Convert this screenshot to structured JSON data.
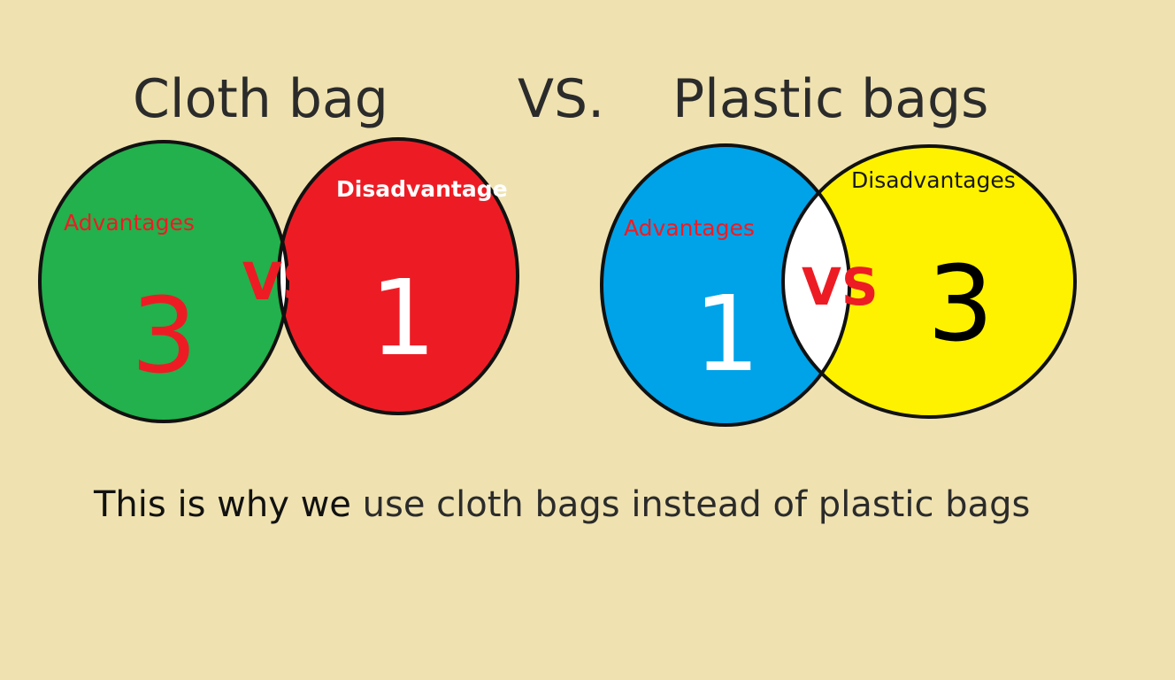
{
  "titles": {
    "left": "Cloth bag",
    "middle": "VS.",
    "right": "Plastic bags"
  },
  "cloth_bag": {
    "advantages_label": "Advantages",
    "advantages_count": "3",
    "disadvantages_label": "Disadvantage",
    "disadvantages_count": "1",
    "vs_label": "VS"
  },
  "plastic_bags": {
    "advantages_label": "Advantages",
    "advantages_count": "1",
    "disadvantages_label": "Disadvantages",
    "disadvantages_count": "3",
    "vs_label": "VS"
  },
  "caption": {
    "part1": "This is why we ",
    "part2": "use cloth bags instead of plastic bags"
  },
  "colors": {
    "background": "#efe2b0",
    "cloth_advantages": "#22b14c",
    "cloth_disadvantages": "#ed1c24",
    "plastic_advantages": "#00a2e8",
    "plastic_disadvantages": "#fff200",
    "overlap": "#ffffff",
    "accent_red": "#ed1c24"
  }
}
